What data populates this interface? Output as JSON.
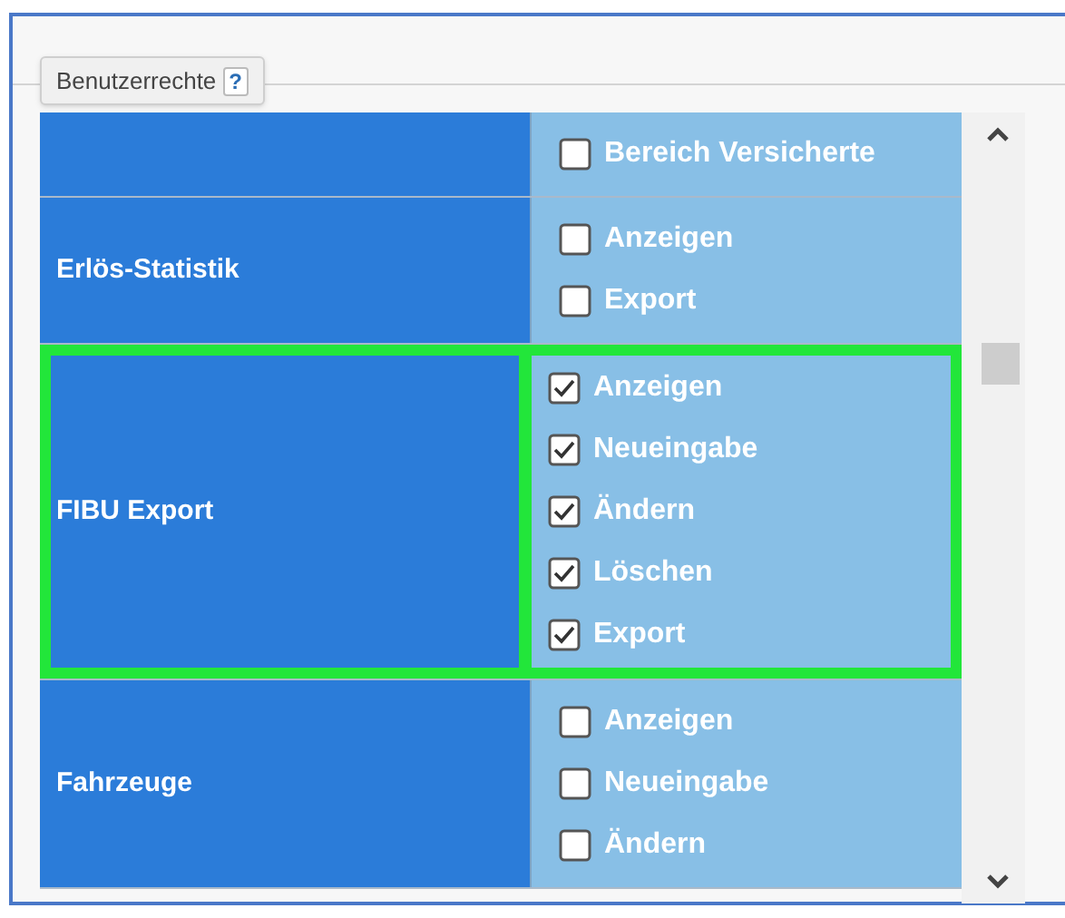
{
  "tab": {
    "label": "Benutzerrechte",
    "help": "?"
  },
  "rows": [
    {
      "label": "",
      "highlighted": false,
      "permissions": [
        {
          "label": "Bereich Versicherte",
          "checked": false
        }
      ]
    },
    {
      "label": "Erlös-Statistik",
      "highlighted": false,
      "permissions": [
        {
          "label": "Anzeigen",
          "checked": false
        },
        {
          "label": "Export",
          "checked": false
        }
      ]
    },
    {
      "label": "FIBU Export",
      "highlighted": true,
      "permissions": [
        {
          "label": "Anzeigen",
          "checked": true
        },
        {
          "label": "Neueingabe",
          "checked": true
        },
        {
          "label": "Ändern",
          "checked": true
        },
        {
          "label": "Löschen",
          "checked": true
        },
        {
          "label": "Export",
          "checked": true
        }
      ]
    },
    {
      "label": "Fahrzeuge",
      "highlighted": false,
      "permissions": [
        {
          "label": "Anzeigen",
          "checked": false
        },
        {
          "label": "Neueingabe",
          "checked": false
        },
        {
          "label": "Ändern",
          "checked": false
        }
      ]
    }
  ]
}
